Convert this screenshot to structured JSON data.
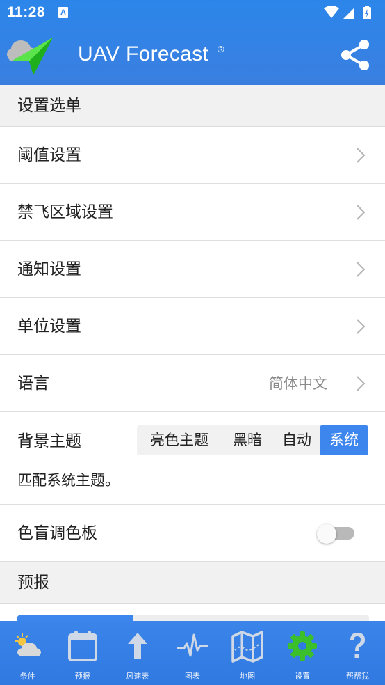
{
  "status_bar": {
    "time": "11:28",
    "notification_icon": "A"
  },
  "app": {
    "title": "UAV Forecast",
    "title_mark": "®"
  },
  "settings_section": {
    "title": "设置选单"
  },
  "rows": [
    {
      "label": "阈值设置"
    },
    {
      "label": "禁飞区域设置"
    },
    {
      "label": "通知设置"
    },
    {
      "label": "单位设置"
    }
  ],
  "language": {
    "label": "语言",
    "value": "简体中文"
  },
  "theme": {
    "label": "背景主题",
    "options": [
      "亮色主题",
      "黑暗",
      "自动",
      "系统"
    ],
    "selected": "系统",
    "description": "匹配系统主题。"
  },
  "colorblind": {
    "label": "色盲调色板",
    "enabled": false
  },
  "forecast_section": {
    "title": "预报"
  },
  "nav": [
    {
      "label": "条件",
      "icon": "weather-icon"
    },
    {
      "label": "预报",
      "icon": "calendar-icon"
    },
    {
      "label": "风速表",
      "icon": "arrow-up-icon"
    },
    {
      "label": "图表",
      "icon": "pulse-chart-icon"
    },
    {
      "label": "地图",
      "icon": "map-icon"
    },
    {
      "label": "设置",
      "icon": "gear-icon",
      "active": true
    },
    {
      "label": "帮帮我",
      "icon": "help-icon"
    }
  ],
  "colors": {
    "primary": "#3a7fe0",
    "active_icon": "#3bbf2a",
    "segment_active": "#3d86ee"
  }
}
